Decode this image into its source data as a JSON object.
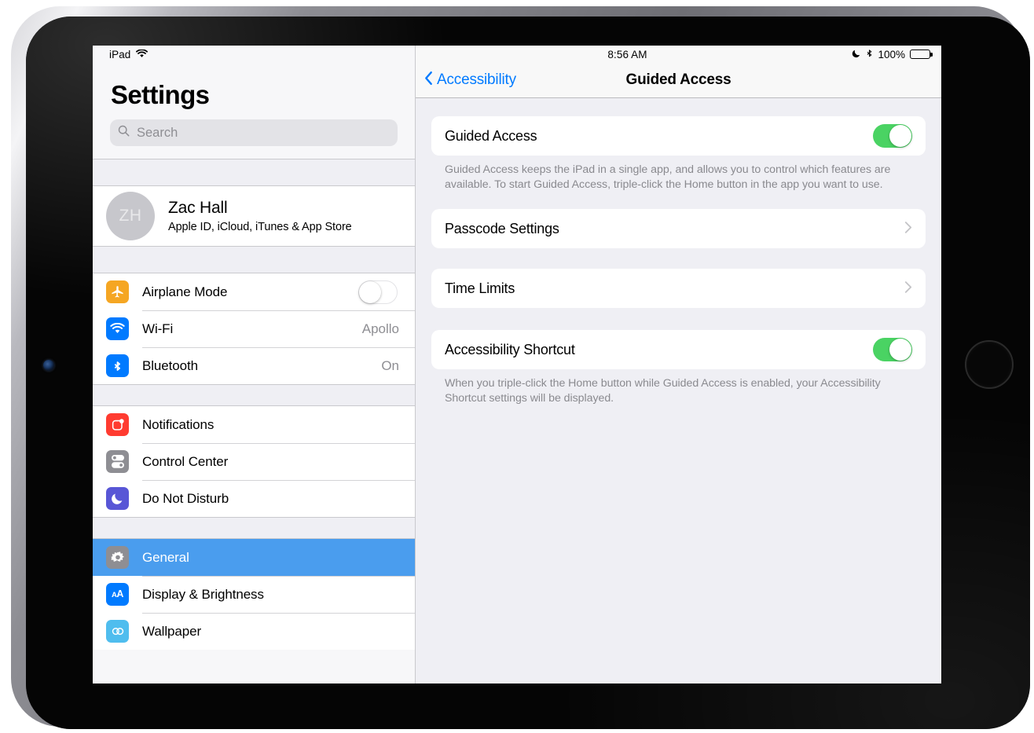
{
  "sidebar": {
    "status": {
      "device_label": "iPad",
      "wifi_icon": "wifi-icon"
    },
    "title": "Settings",
    "search": {
      "placeholder": "Search",
      "value": "",
      "icon": "search-icon"
    },
    "account": {
      "initials": "ZH",
      "name": "Zac Hall",
      "subtitle": "Apple ID, iCloud, iTunes & App Store"
    },
    "groups": [
      {
        "items": [
          {
            "label": "Airplane Mode",
            "icon": "airplane-icon",
            "icon_color": "#F5A623",
            "control": "toggle",
            "toggle_on": false
          },
          {
            "label": "Wi-Fi",
            "icon": "wifi-icon",
            "icon_color": "#007AFF",
            "control": "value",
            "value": "Apollo"
          },
          {
            "label": "Bluetooth",
            "icon": "bluetooth-icon",
            "icon_color": "#007AFF",
            "control": "value",
            "value": "On"
          }
        ]
      },
      {
        "items": [
          {
            "label": "Notifications",
            "icon": "notifications-icon",
            "icon_color": "#FF3B30",
            "control": "none"
          },
          {
            "label": "Control Center",
            "icon": "control-center-icon",
            "icon_color": "#8E8E93",
            "control": "none"
          },
          {
            "label": "Do Not Disturb",
            "icon": "moon-icon",
            "icon_color": "#5856D6",
            "control": "none"
          }
        ]
      },
      {
        "items": [
          {
            "label": "General",
            "icon": "gear-icon",
            "icon_color": "#8E8E93",
            "control": "none",
            "selected": true
          },
          {
            "label": "Display & Brightness",
            "icon": "text-size-icon",
            "icon_color": "#007AFF",
            "control": "none"
          },
          {
            "label": "Wallpaper",
            "icon": "wallpaper-icon",
            "icon_color": "#4FBDEE",
            "control": "none"
          }
        ]
      }
    ]
  },
  "detail": {
    "status": {
      "time": "8:56 AM",
      "dnd_icon": "moon-icon",
      "bluetooth_icon": "bluetooth-icon",
      "battery_percent": "100%",
      "battery_icon": "battery-full-icon"
    },
    "nav": {
      "back_label": "Accessibility",
      "back_icon": "chevron-left-icon",
      "title": "Guided Access"
    },
    "sections": [
      {
        "row_label": "Guided Access",
        "control": "toggle",
        "toggle_on": true,
        "footnote": "Guided Access keeps the iPad in a single app, and allows you to control which features are available. To start Guided Access, triple-click the Home button in the app you want to use."
      },
      {
        "row_label": "Passcode Settings",
        "control": "chevron",
        "chevron_icon": "chevron-right-icon"
      },
      {
        "row_label": "Time Limits",
        "control": "chevron",
        "chevron_icon": "chevron-right-icon"
      },
      {
        "row_label": "Accessibility Shortcut",
        "control": "toggle",
        "toggle_on": true,
        "footnote": "When you triple-click the Home button while Guided Access is enabled, your Accessibility Shortcut settings will be displayed."
      }
    ]
  },
  "colors": {
    "accent_blue": "#007AFF",
    "toggle_green": "#4AD363",
    "selected_row": "#4A9DEE",
    "sidebar_bg": "#F7F7F9",
    "detail_bg": "#EFEFF4"
  }
}
